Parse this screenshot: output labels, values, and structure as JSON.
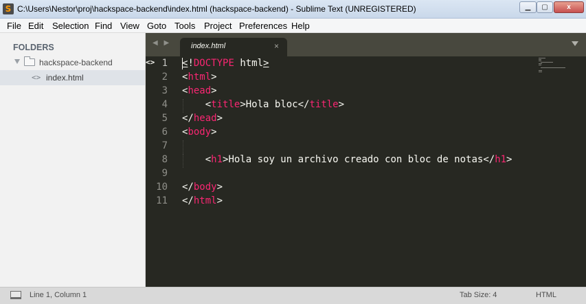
{
  "window": {
    "app_icon": "S",
    "title": "C:\\Users\\Nestor\\proj\\hackspace-backend\\index.html (hackspace-backend) - Sublime Text (UNREGISTERED)",
    "minimize_icon": "minimize-icon",
    "maximize_icon": "maximize-icon",
    "close_icon": "close-icon",
    "close_glyph": "x"
  },
  "menu": [
    "File",
    "Edit",
    "Selection",
    "Find",
    "View",
    "Goto",
    "Tools",
    "Project",
    "Preferences",
    "Help"
  ],
  "sidebar": {
    "heading": "FOLDERS",
    "folder": "hackspace-backend",
    "file": "index.html",
    "file_icon": "<>"
  },
  "tabs": {
    "active_label": "index.html",
    "close_glyph": "×",
    "nav_glyph": "◀ ▶"
  },
  "editor": {
    "gutter_marker": "<>",
    "line_numbers": [
      "1",
      "2",
      "3",
      "4",
      "5",
      "6",
      "7",
      "8",
      "9",
      "10",
      "11"
    ],
    "lines": [
      "<!DOCTYPE html>",
      "<html>",
      "<head>",
      "    <title>Hola bloc</title>",
      "</head>",
      "<body>",
      "",
      "    <h1>Hola soy un archivo creado con bloc de notas</h1>",
      "",
      "</body>",
      "</html>"
    ],
    "colors": {
      "background": "#272822",
      "tag": "#f92672",
      "text": "#f8f8f2",
      "line_number": "#90908a"
    }
  },
  "status": {
    "position": "Line 1, Column 1",
    "tab_size": "Tab Size: 4",
    "syntax": "HTML"
  }
}
